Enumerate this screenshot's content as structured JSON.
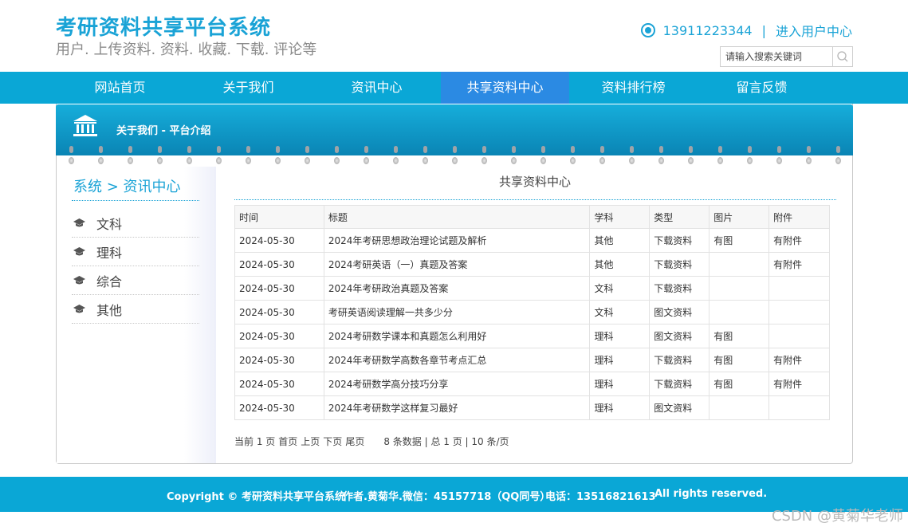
{
  "header": {
    "title": "考研资料共享平台系统",
    "subtitle": "用户. 上传资料. 资料. 收藏. 下载. 评论等",
    "phone": "13911223344",
    "separator": "|",
    "user_center": "进入用户中心",
    "search_placeholder": "请输入搜索关键词"
  },
  "nav": {
    "items": [
      {
        "label": "网站首页"
      },
      {
        "label": "关于我们"
      },
      {
        "label": "资讯中心"
      },
      {
        "label": "共享资料中心"
      },
      {
        "label": "资料排行榜"
      },
      {
        "label": "留言反馈"
      }
    ],
    "active_index": 3
  },
  "banner": {
    "text": "关于我们 - 平台介绍"
  },
  "sidebar": {
    "breadcrumb": "系统 > 资讯中心",
    "items": [
      {
        "label": "文科"
      },
      {
        "label": "理科"
      },
      {
        "label": "综合"
      },
      {
        "label": "其他"
      }
    ]
  },
  "content": {
    "title": "共享资料中心",
    "columns": [
      "时间",
      "标题",
      "学科",
      "类型",
      "图片",
      "附件"
    ],
    "rows": [
      [
        "2024-05-30",
        "2024年考研思想政治理论试题及解析",
        "其他",
        "下载资料",
        "有图",
        "有附件"
      ],
      [
        "2024-05-30",
        "2024考研英语（一）真题及答案",
        "其他",
        "下载资料",
        "",
        "有附件"
      ],
      [
        "2024-05-30",
        "2024年考研政治真题及答案",
        "文科",
        "下载资料",
        "",
        ""
      ],
      [
        "2024-05-30",
        "考研英语阅读理解一共多少分",
        "文科",
        "图文资料",
        "",
        ""
      ],
      [
        "2024-05-30",
        "2024考研数学课本和真题怎么利用好",
        "理科",
        "图文资料",
        "有图",
        ""
      ],
      [
        "2024-05-30",
        "2024年考研数学高数各章节考点汇总",
        "理科",
        "下载资料",
        "有图",
        "有附件"
      ],
      [
        "2024-05-30",
        "2024考研数学高分技巧分享",
        "理科",
        "下载资料",
        "有图",
        "有附件"
      ],
      [
        "2024-05-30",
        "2024年考研数学这样复习最好",
        "理科",
        "图文资料",
        "",
        ""
      ]
    ]
  },
  "pager": {
    "current": "当前 1 页",
    "first": "首页",
    "prev": "上页",
    "next": "下页",
    "last": "尾页",
    "stats": "8 条数据 | 总 1 页 | 10 条/页"
  },
  "footer": {
    "copyright": "Copyright © 考研资料共享平台系统",
    "author": "作者.黄菊华.微信：45157718（QQ同号）",
    "phone": "电话：13516821613",
    "rights": "All rights reserved."
  },
  "watermark": "CSDN @黄菊华老师",
  "colors": {
    "accent": "#0aa7d6",
    "nav_active": "#2b8ae3",
    "title": "#1aa3d6"
  }
}
